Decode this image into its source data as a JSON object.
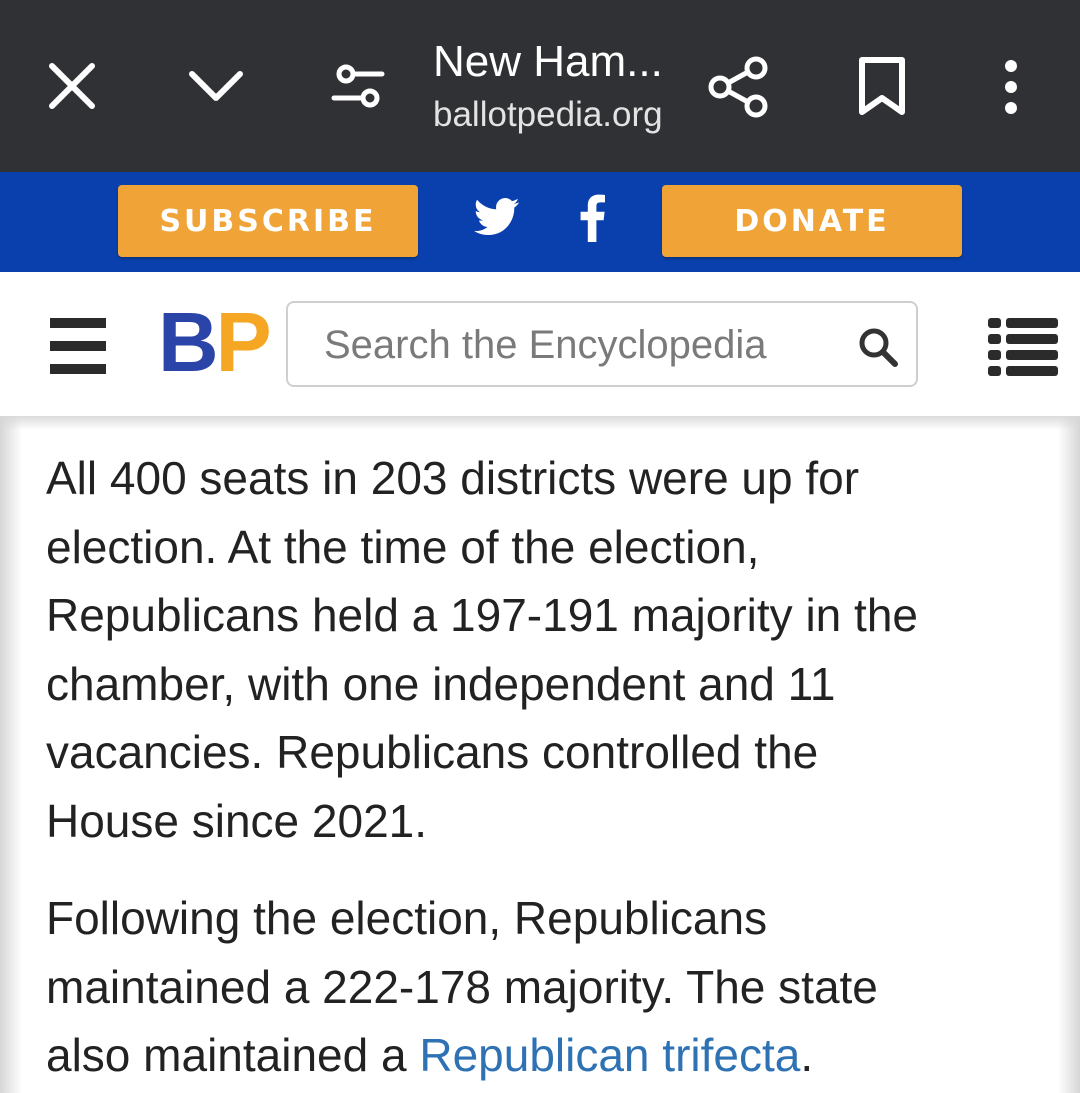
{
  "browser": {
    "title": "New Ham...",
    "url": "ballotpedia.org",
    "icons": [
      "close-icon",
      "chevron-down-icon",
      "tune-icon",
      "share-icon",
      "bookmark-icon",
      "more-vert-icon"
    ]
  },
  "actions": {
    "subscribe_label": "SUBSCRIBE",
    "donate_label": "DONATE",
    "button_color": "#f0a336",
    "band_color": "#0940ad"
  },
  "site_header": {
    "logo_b": "B",
    "logo_p": "P",
    "search_placeholder": "Search the Encyclopedia"
  },
  "article": {
    "lines_p1": [
      "All 400 seats in 203 districts were up for",
      "election. At the time of the election,",
      "Republicans held a 197-191 majority in the",
      "chamber, with one independent and 11",
      "vacancies. Republicans controlled the",
      "House since 2021."
    ],
    "lines_p2": [
      "Following the election, Republicans",
      "maintained a 222-178 majority. The state"
    ],
    "p2_line3_text": "also maintained a ",
    "p2_link": "Republican trifecta",
    "p2_end": ".",
    "link_color": "#2e72b4"
  }
}
